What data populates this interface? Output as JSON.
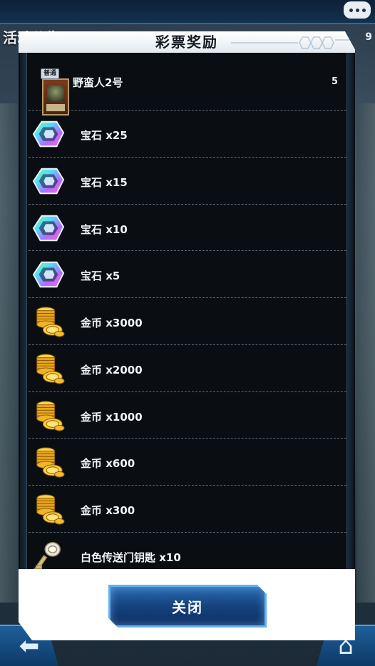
{
  "background": {
    "screen_title": "活动公告",
    "corner_number": "9"
  },
  "dialog": {
    "title": "彩票奖励",
    "close_label": "关闭",
    "card_badge": "普通"
  },
  "rewards": [
    {
      "label": "野蛮人2号",
      "qty": "5",
      "icon": "monster-card-icon"
    },
    {
      "label": "宝石 x25",
      "qty": "",
      "icon": "gem-icon"
    },
    {
      "label": "宝石 x15",
      "qty": "",
      "icon": "gem-icon"
    },
    {
      "label": "宝石 x10",
      "qty": "",
      "icon": "gem-icon"
    },
    {
      "label": "宝石 x5",
      "qty": "",
      "icon": "gem-icon"
    },
    {
      "label": "金币 x3000",
      "qty": "",
      "icon": "gold-coins-icon"
    },
    {
      "label": "金币 x2000",
      "qty": "",
      "icon": "gold-coins-icon"
    },
    {
      "label": "金币 x1000",
      "qty": "",
      "icon": "gold-coins-icon"
    },
    {
      "label": "金币 x600",
      "qty": "",
      "icon": "gold-coins-icon"
    },
    {
      "label": "金币 x300",
      "qty": "",
      "icon": "gold-coins-icon"
    },
    {
      "label": "白色传送门钥匙 x10",
      "qty": "",
      "icon": "white-gate-key-icon"
    }
  ],
  "colors": {
    "panel_bg": "#0a0e13",
    "accent_blue": "#2b6cb0",
    "text": "#f2f4f6"
  }
}
